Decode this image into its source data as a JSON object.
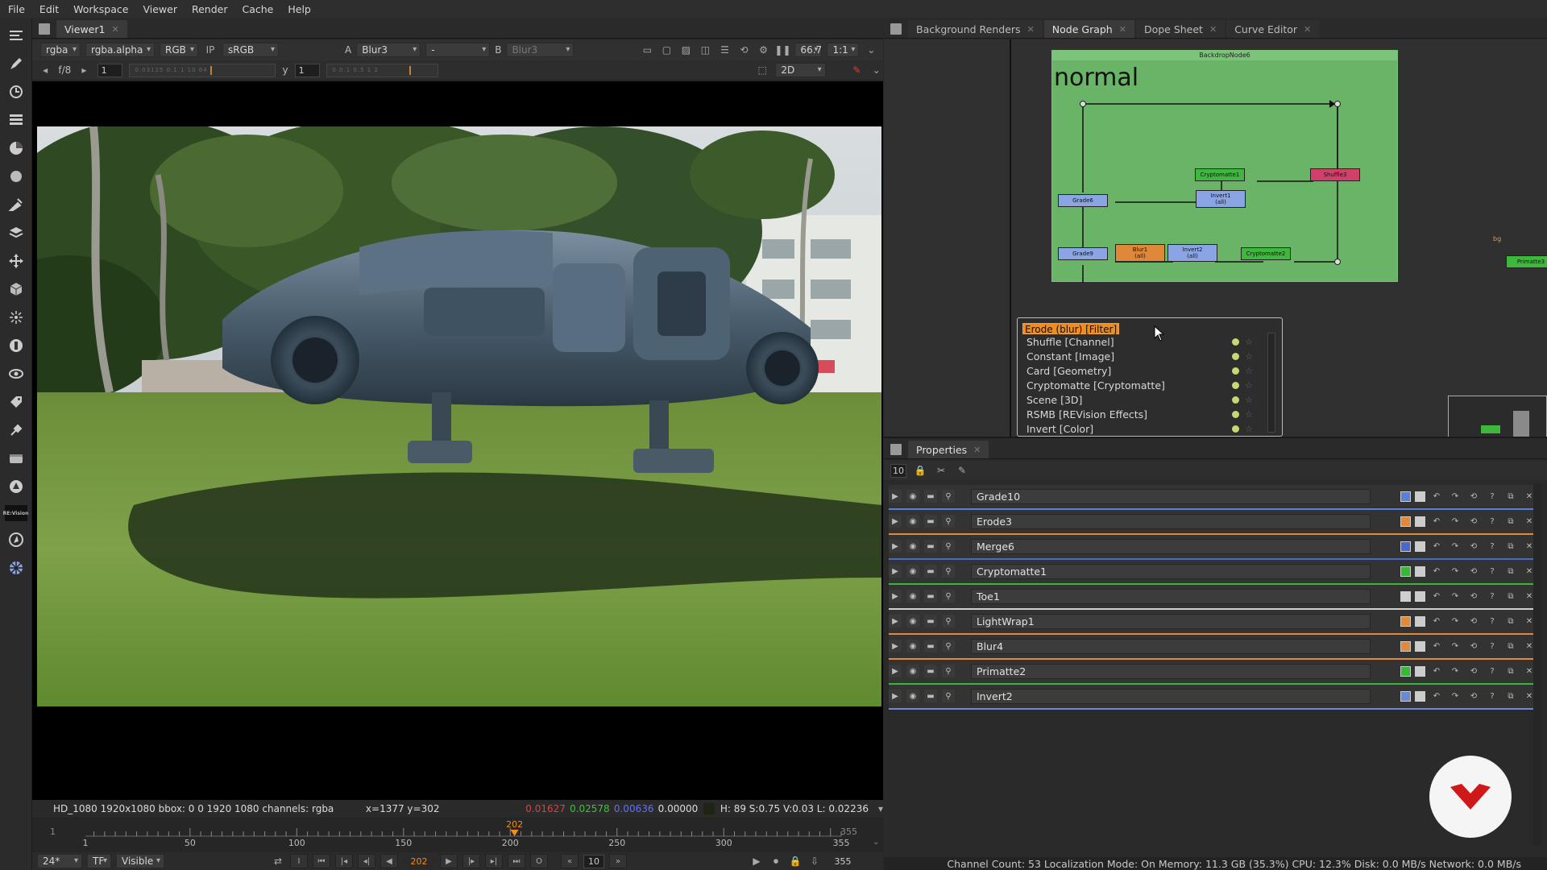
{
  "menu": [
    "File",
    "Edit",
    "Workspace",
    "Viewer",
    "Render",
    "Cache",
    "Help"
  ],
  "viewer": {
    "tab_label": "Viewer1",
    "channels": "rgba",
    "alpha": "rgba.alpha",
    "colorspace_rgb": "RGB",
    "lut": "sRGB",
    "input_a_label": "A",
    "input_a": "Blur3",
    "wipe": "-",
    "input_b_label": "B",
    "input_b": "Blur3",
    "zoom": "66.7",
    "ratio": "1:1",
    "fstop": "f/8",
    "gain": "1",
    "gamma_label": "y",
    "gamma": "1",
    "gain_ticks": "0.03125  0.1     1     10   64",
    "gamma_ticks": "0   0.1   0.5   1    2",
    "view_mode": "2D"
  },
  "infobar": {
    "format": "HD_1080 1920x1080  bbox: 0 0 1920 1080 channels: rgba",
    "coords": "x=1377 y=302",
    "r": "0.01627",
    "g": "0.02578",
    "b": "0.00636",
    "a": "0.00000",
    "hsv": "H: 89 S:0.75 V:0.03  L: 0.02236"
  },
  "timeline": {
    "start": "1",
    "end": "355",
    "current": "202",
    "ticks": [
      "1",
      "50",
      "100",
      "150",
      "200",
      "250",
      "300",
      "355"
    ],
    "fps": "24*",
    "tf": "TF",
    "visible": "Visible",
    "frame_field": "202",
    "step": "10",
    "end_field": "355",
    "in_label": "I",
    "out_label": "O"
  },
  "nodepanel": {
    "tabs": [
      "Background Renders",
      "Node Graph",
      "Dope Sheet",
      "Curve Editor"
    ],
    "active_tab": 1,
    "backdrop_title": "BackdropNode6",
    "backdrop_label": "normal",
    "nodes": {
      "cryptomatte1": "Cryptomatte1",
      "shuffle3": "Shuffle3",
      "grade6": "Grade6",
      "invert1": "Invert1\n(all)",
      "grade9": "Grade9",
      "blur1": "Blur1\n(all)",
      "invert2": "Invert2\n(all)",
      "cryptomatte2": "Cryptomatte2",
      "primatte3": "Primatte3",
      "bg": "bg"
    }
  },
  "nodemenu": {
    "search": "Erode (blur) [Filter]",
    "items": [
      "Shuffle [Channel]",
      "Constant [Image]",
      "Card [Geometry]",
      "Cryptomatte [Cryptomatte]",
      "Scene [3D]",
      "RSMB [REVision Effects]",
      "Invert [Color]"
    ]
  },
  "properties": {
    "tab_label": "Properties",
    "max_panels": "10",
    "rows": [
      {
        "name": "Grade10",
        "color": "#5a7fd8"
      },
      {
        "name": "Erode3",
        "color": "#e08a3a"
      },
      {
        "name": "Merge6",
        "color": "#4a66d0"
      },
      {
        "name": "Cryptomatte1",
        "color": "#38b838"
      },
      {
        "name": "Toe1",
        "color": "#cfcfcf"
      },
      {
        "name": "LightWrap1",
        "color": "#e08a3a"
      },
      {
        "name": "Blur4",
        "color": "#e08a3a"
      },
      {
        "name": "Primatte2",
        "color": "#38b838"
      },
      {
        "name": "Invert2",
        "color": "#6a8ad8"
      }
    ]
  },
  "status": "Channel Count: 53 Localization Mode: On Memory: 11.3 GB (35.3%) CPU: 12.3% Disk: 0.0 MB/s Network: 0.0 MB/s",
  "colors": {
    "accent_orange": "#f08c20",
    "backdrop_green": "#6ab468",
    "red_value": "#e04040",
    "green_value": "#40c040",
    "blue_value": "#5060ff"
  }
}
